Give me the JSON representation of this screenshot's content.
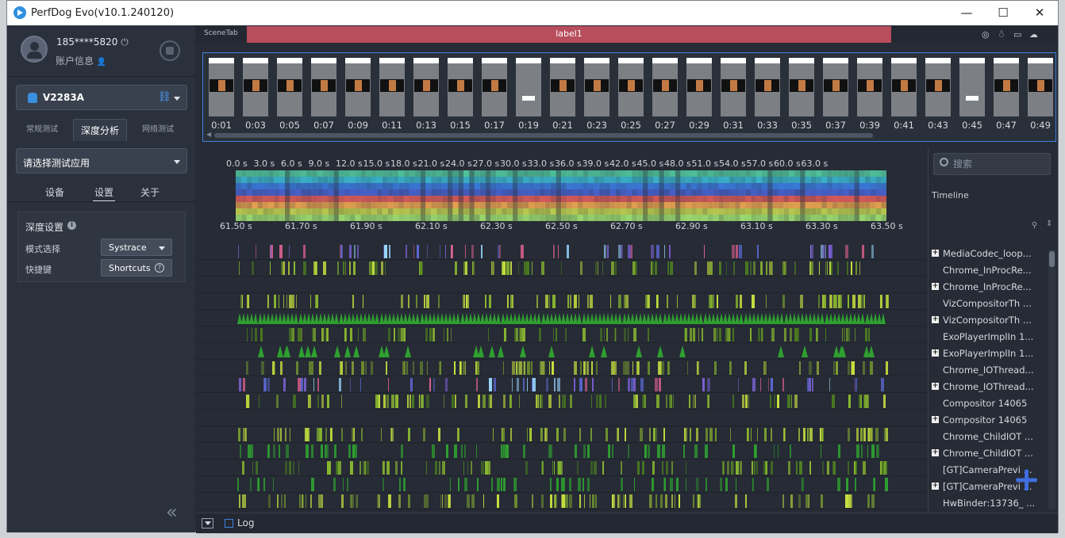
{
  "window": {
    "title": "PerfDog Evo(v10.1.240120)",
    "minimize": "—",
    "maximize": "☐",
    "close": "✕"
  },
  "user": {
    "phone": "185****5820",
    "account_label": "账户信息"
  },
  "device": {
    "name": "V2283A"
  },
  "tabs": [
    "常规测试",
    "深度分析",
    "网络测试"
  ],
  "app_select": {
    "placeholder": "请选择测试应用"
  },
  "subtabs": [
    "设备",
    "设置",
    "关于"
  ],
  "depth_settings": {
    "title": "深度设置",
    "mode_label": "模式选择",
    "mode_value": "Systrace",
    "shortcut_label": "快捷键",
    "shortcut_value": "Shortcuts"
  },
  "scene": {
    "tab_label": "SceneTab",
    "label": "label1"
  },
  "thumbnails": [
    "0:01",
    "0:03",
    "0:05",
    "0:07",
    "0:09",
    "0:11",
    "0:13",
    "0:15",
    "0:17",
    "0:19",
    "0:21",
    "0:23",
    "0:25",
    "0:27",
    "0:29",
    "0:31",
    "0:33",
    "0:35",
    "0:37",
    "0:39",
    "0:41",
    "0:43",
    "0:45",
    "0:47",
    "0:49"
  ],
  "ruler_top": [
    "0.0 s",
    "3.0 s",
    "6.0 s",
    "9.0 s",
    "12.0 s",
    "15.0 s",
    "18.0 s",
    "21.0 s",
    "24.0 s",
    "27.0 s",
    "30.0 s",
    "33.0 s",
    "36.0 s",
    "39.0 s",
    "42.0 s",
    "45.0 s",
    "48.0 s",
    "51.0 s",
    "54.0 s",
    "57.0 s",
    "60.0 s",
    "63.0 s"
  ],
  "ruler_bottom": [
    "61.50 s",
    "61.70 s",
    "61.90 s",
    "62.10 s",
    "62.30 s",
    "62.50 s",
    "62.70 s",
    "62.90 s",
    "63.10 s",
    "63.30 s",
    "63.50 s"
  ],
  "search": {
    "placeholder": "搜索"
  },
  "timeline": {
    "title": "Timeline",
    "rows": [
      {
        "label": "MediaCodec_loop...",
        "expand": true
      },
      {
        "label": "Chrome_InProcRe...",
        "expand": false
      },
      {
        "label": "Chrome_InProcRe...",
        "expand": true
      },
      {
        "label": "VizCompositorTh ...",
        "expand": false
      },
      {
        "label": "VizCompositorTh ...",
        "expand": true
      },
      {
        "label": "ExoPlayerImplIn 1...",
        "expand": false
      },
      {
        "label": "ExoPlayerImplIn 1...",
        "expand": true
      },
      {
        "label": "Chrome_IOThread...",
        "expand": false
      },
      {
        "label": "Chrome_IOThread...",
        "expand": true
      },
      {
        "label": "Compositor 14065",
        "expand": false
      },
      {
        "label": "Compositor 14065",
        "expand": true
      },
      {
        "label": "Chrome_ChildIOT ...",
        "expand": false
      },
      {
        "label": "Chrome_ChildIOT ...",
        "expand": true
      },
      {
        "label": "[GT]CameraPrevi ...",
        "expand": false
      },
      {
        "label": "[GT]CameraPrevi ...",
        "expand": true
      },
      {
        "label": "HwBinder:13736_ ...",
        "expand": false
      }
    ]
  },
  "bottom": {
    "log_label": "Log"
  },
  "colors": {
    "accent": "#3f82e0",
    "scene_label": "#b84d5c",
    "panel": "#2b313c"
  }
}
